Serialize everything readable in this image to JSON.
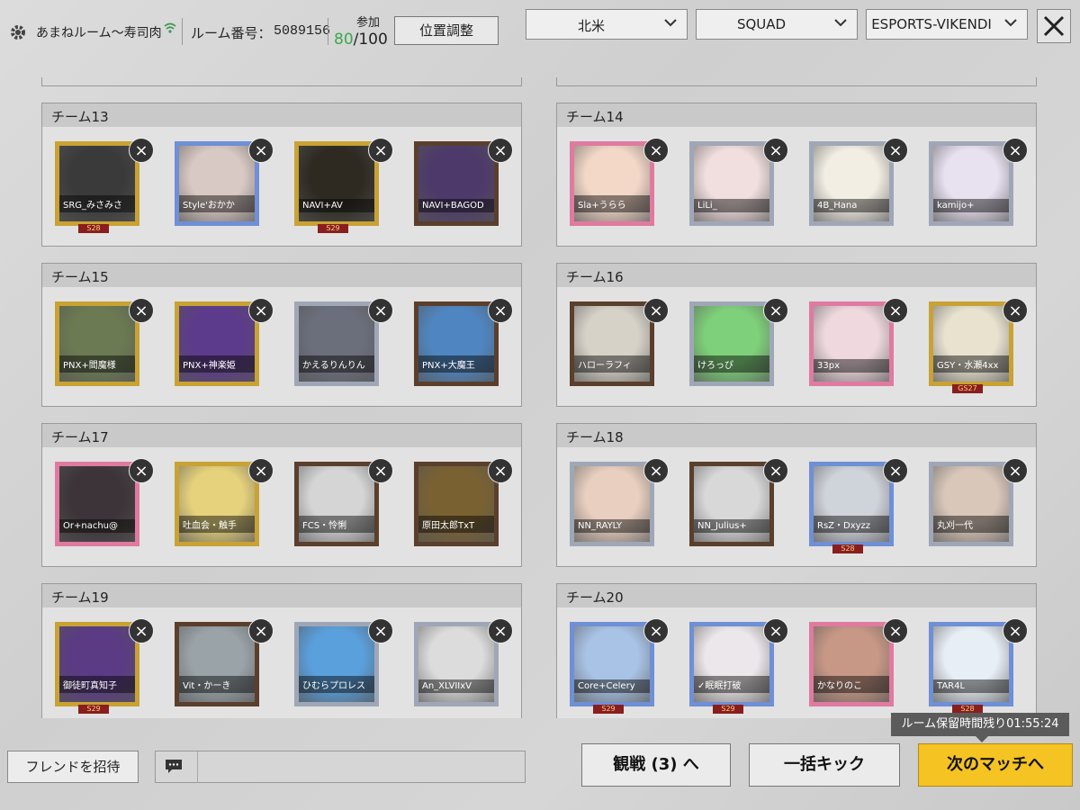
{
  "header": {
    "room_name": "あまねルーム〜寿司肉",
    "room_number_label": "ルーム番号：",
    "room_number": "5089156",
    "join_label": "参加",
    "join_current": "80",
    "join_total": "/100",
    "position_button": "位置調整",
    "region": "北米",
    "mode": "SQUAD",
    "map": "ESPORTS-VIKENDI"
  },
  "teams": [
    {
      "title": "チーム13",
      "players": [
        {
          "name": "SRG_みさみさ",
          "season": "S28",
          "frame": "gold",
          "color": "#3a3a3a"
        },
        {
          "name": "Style'おかか",
          "season": "",
          "frame": "blue",
          "color": "#d9c9c4"
        },
        {
          "name": "NAVI+AV",
          "season": "S29",
          "frame": "gold",
          "color": "#2e2a22"
        },
        {
          "name": "NAVI+BAGOD",
          "season": "",
          "frame": "dark",
          "color": "#4d3a6a"
        }
      ]
    },
    {
      "title": "チーム14",
      "players": [
        {
          "name": "Sla+うらら",
          "season": "",
          "frame": "pink",
          "color": "#f3d8c8"
        },
        {
          "name": "LiLi_",
          "season": "",
          "frame": "silver",
          "color": "#f1dede"
        },
        {
          "name": "4B_Hana",
          "season": "",
          "frame": "silver",
          "color": "#f2eee4"
        },
        {
          "name": "kamijo+",
          "season": "",
          "frame": "silver",
          "color": "#e8e1f0"
        }
      ]
    },
    {
      "title": "チーム15",
      "players": [
        {
          "name": "PNX+閻魔様",
          "season": "",
          "frame": "gold",
          "color": "#6b7a52"
        },
        {
          "name": "PNX+神楽姫",
          "season": "",
          "frame": "gold",
          "color": "#5d3b8c"
        },
        {
          "name": "かえるりんりん",
          "season": "",
          "frame": "silver",
          "color": "#6b6f7c"
        },
        {
          "name": "PNX+大魔王",
          "season": "",
          "frame": "dark",
          "color": "#4f86c2"
        }
      ]
    },
    {
      "title": "チーム16",
      "players": [
        {
          "name": "ハローラフィ",
          "season": "",
          "frame": "dark",
          "color": "#d7d2c8"
        },
        {
          "name": "けろっぴ",
          "season": "",
          "frame": "silver",
          "color": "#7ed07a"
        },
        {
          "name": "33px",
          "season": "",
          "frame": "pink",
          "color": "#efd9df"
        },
        {
          "name": "GSY・水瀬4xx",
          "season": "GS27",
          "frame": "gold",
          "color": "#e8e2cf"
        }
      ]
    },
    {
      "title": "チーム17",
      "players": [
        {
          "name": "Or+nachu@",
          "season": "",
          "frame": "pink",
          "color": "#3c3438"
        },
        {
          "name": "吐血会・触手",
          "season": "",
          "frame": "gold",
          "color": "#e6d27c"
        },
        {
          "name": "FCS・怜悧",
          "season": "",
          "frame": "dark",
          "color": "#d5d5d5"
        },
        {
          "name": "原田太郎TxT",
          "season": "",
          "frame": "dark",
          "color": "#7a6132"
        }
      ]
    },
    {
      "title": "チーム18",
      "players": [
        {
          "name": "NN_RAYLY",
          "season": "",
          "frame": "silver",
          "color": "#e8cfc0"
        },
        {
          "name": "NN_Julius+",
          "season": "",
          "frame": "dark",
          "color": "#d8d8d8"
        },
        {
          "name": "RsZ・Dxyzz",
          "season": "S28",
          "frame": "blue",
          "color": "#cfd3da"
        },
        {
          "name": "丸刈一代",
          "season": "",
          "frame": "silver",
          "color": "#d9c7ba"
        }
      ]
    },
    {
      "title": "チーム19",
      "players": [
        {
          "name": "御徒町真知子",
          "season": "S29",
          "frame": "gold",
          "color": "#5a3b84"
        },
        {
          "name": "Vit・かーき",
          "season": "",
          "frame": "dark",
          "color": "#9aa3a8"
        },
        {
          "name": "ひむらプロレス",
          "season": "",
          "frame": "silver",
          "color": "#5aa0dd"
        },
        {
          "name": "An_XLVIIxV",
          "season": "",
          "frame": "silver",
          "color": "#dcdcdc"
        }
      ]
    },
    {
      "title": "チーム20",
      "players": [
        {
          "name": "Core+Celery",
          "season": "S29",
          "frame": "blue",
          "color": "#a9c3e6"
        },
        {
          "name": "✓眠眠打破",
          "season": "S29",
          "frame": "blue",
          "color": "#ece7ea"
        },
        {
          "name": "かなりのこ",
          "season": "",
          "frame": "pink",
          "color": "#c89886"
        },
        {
          "name": "TAR4L",
          "season": "S28",
          "frame": "blue",
          "color": "#e7eef5"
        }
      ]
    }
  ],
  "footer": {
    "invite_button": "フレンドを招待",
    "spectate_button": "観戦 (3) へ",
    "bulk_kick_button": "一括キック",
    "next_match_button": "次のマッチへ",
    "timer_text": "ルーム保留時間残り01:55:24"
  }
}
